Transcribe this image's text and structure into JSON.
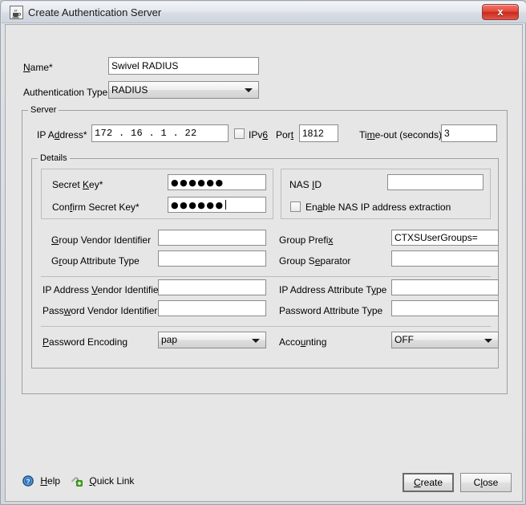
{
  "window": {
    "title": "Create Authentication Server",
    "app_icon": "java-coffee-cup-icon",
    "close_label": "x"
  },
  "form": {
    "name_label": "Name*",
    "name_value": "Swivel RADIUS",
    "auth_type_label": "Authentication Type",
    "auth_type_value": "RADIUS"
  },
  "server": {
    "title": "Server",
    "ip_label": "IP Address*",
    "ip_value": "172 .  16  .  1    .  22",
    "ipv6_label": "IPv6",
    "ipv6_checked": false,
    "port_label": "Port",
    "port_value": "1812",
    "timeout_label": "Time-out (seconds)",
    "timeout_value": "3"
  },
  "details": {
    "title": "Details",
    "secret_key_label": "Secret Key*",
    "secret_key_value": "●●●●●●",
    "confirm_secret_key_label": "Confirm Secret Key*",
    "confirm_secret_key_value": "●●●●●●",
    "nas_id_label": "NAS ID",
    "nas_id_value": "",
    "enable_nas_label": "Enable NAS IP address extraction",
    "enable_nas_checked": false,
    "group_vendor_id_label": "Group Vendor Identifier",
    "group_vendor_id_value": "",
    "group_attr_type_label": "Group Attribute Type",
    "group_attr_type_value": "",
    "group_prefix_label": "Group Prefix",
    "group_prefix_value": "CTXSUserGroups=",
    "group_separator_label": "Group Separator",
    "group_separator_value": "",
    "ip_vendor_id_label": "IP Address Vendor Identifier",
    "ip_vendor_id_value": "",
    "password_vendor_id_label": "Password Vendor Identifier",
    "password_vendor_id_value": "",
    "ip_attr_type_label": "IP Address Attribute Type",
    "ip_attr_type_value": "",
    "password_attr_type_label": "Password Attribute Type",
    "password_attr_type_value": "",
    "password_encoding_label": "Password Encoding",
    "password_encoding_value": "pap",
    "accounting_label": "Accounting",
    "accounting_value": "OFF"
  },
  "footer": {
    "help_label": "Help",
    "quick_link_label": "Quick Link",
    "create_label": "Create",
    "close_label": "Close"
  }
}
